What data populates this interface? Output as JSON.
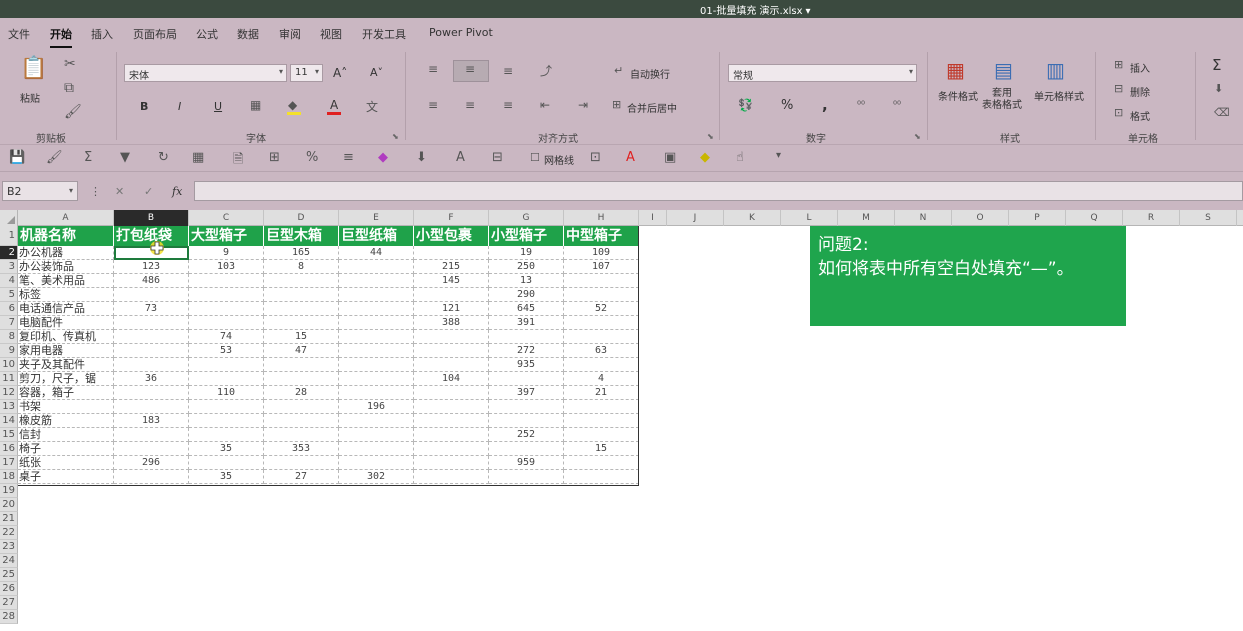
{
  "window": {
    "title": "01-批量填充 演示.xlsx"
  },
  "ribbon": {
    "tabs": [
      "文件",
      "开始",
      "插入",
      "页面布局",
      "公式",
      "数据",
      "审阅",
      "视图",
      "开发工具",
      "Power Pivot"
    ],
    "active_tab": "开始",
    "clipboard": {
      "paste_label": "粘贴",
      "group_label": "剪贴板"
    },
    "font": {
      "name": "宋体",
      "size": "11",
      "group_label": "字体",
      "bold": "B",
      "italic": "I",
      "underline": "U",
      "grow": "A˄",
      "shrink": "A˅",
      "font_color_glyph": "A",
      "font_color": "#e02020",
      "fill_color": "#f4e12a"
    },
    "alignment": {
      "wrap_label": "自动换行",
      "merge_label": "合并后居中",
      "group_label": "对齐方式"
    },
    "number": {
      "format": "常规",
      "group_label": "数字",
      "percent": "%",
      "comma": ","
    },
    "styles": {
      "conditional_label": "条件格式",
      "table_label": "套用\n表格格式",
      "cell_style_label": "单元格样式",
      "group_label": "样式"
    },
    "cells": {
      "insert_label": "插入",
      "delete_label": "删除",
      "format_label": "格式",
      "group_label": "单元格"
    },
    "editing": {
      "sum": "Σ"
    }
  },
  "qat": {
    "percent": "%",
    "gridlines_label": "网格线"
  },
  "formula_bar": {
    "name_box": "B2",
    "fx": "fx",
    "value": ""
  },
  "sheet": {
    "columns": [
      "A",
      "B",
      "C",
      "D",
      "E",
      "F",
      "G",
      "H",
      "I",
      "J",
      "K",
      "L",
      "M",
      "N",
      "O",
      "P",
      "Q",
      "R",
      "S"
    ],
    "selected_column": "B",
    "row_numbers": [
      "1",
      "2",
      "3",
      "4",
      "5",
      "6",
      "7",
      "8",
      "9",
      "10",
      "11",
      "12",
      "13",
      "14",
      "15",
      "16",
      "17",
      "18",
      "19",
      "20",
      "21",
      "22",
      "23",
      "24",
      "25",
      "26",
      "27",
      "28"
    ],
    "selected_row": "2",
    "headers": [
      "机器名称",
      "打包纸袋",
      "大型箱子",
      "巨型木箱",
      "巨型纸箱",
      "小型包裹",
      "小型箱子",
      "中型箱子"
    ],
    "rows": [
      [
        "办公机器",
        "",
        "9",
        "165",
        "44",
        "",
        "19",
        "109"
      ],
      [
        "办公装饰品",
        "123",
        "103",
        "8",
        "",
        "215",
        "250",
        "107"
      ],
      [
        "笔、美术用品",
        "486",
        "",
        "",
        "",
        "145",
        "13",
        ""
      ],
      [
        "标签",
        "",
        "",
        "",
        "",
        "",
        "290",
        ""
      ],
      [
        "电话通信产品",
        "73",
        "",
        "",
        "",
        "121",
        "645",
        "52"
      ],
      [
        "电脑配件",
        "",
        "",
        "",
        "",
        "388",
        "391",
        ""
      ],
      [
        "复印机、传真机",
        "",
        "74",
        "15",
        "",
        "",
        "",
        ""
      ],
      [
        "家用电器",
        "",
        "53",
        "47",
        "",
        "",
        "272",
        "63"
      ],
      [
        "夹子及其配件",
        "",
        "",
        "",
        "",
        "",
        "935",
        ""
      ],
      [
        "剪刀，尺子，锯",
        "36",
        "",
        "",
        "",
        "104",
        "",
        "4"
      ],
      [
        "容器，箱子",
        "",
        "110",
        "28",
        "",
        "",
        "397",
        "21"
      ],
      [
        "书架",
        "",
        "",
        "",
        "196",
        "",
        "",
        ""
      ],
      [
        "橡皮筋",
        "183",
        "",
        "",
        "",
        "",
        "",
        ""
      ],
      [
        "信封",
        "",
        "",
        "",
        "",
        "",
        "252",
        ""
      ],
      [
        "椅子",
        "",
        "35",
        "353",
        "",
        "",
        "",
        "15"
      ],
      [
        "纸张",
        "296",
        "",
        "",
        "",
        "",
        "959",
        ""
      ],
      [
        "桌子",
        "",
        "35",
        "27",
        "302",
        "",
        "",
        ""
      ]
    ]
  },
  "note": {
    "line1": "问题2:",
    "line2": "如何将表中所有空白处填充“—”。",
    "color": "#1fa54d"
  }
}
